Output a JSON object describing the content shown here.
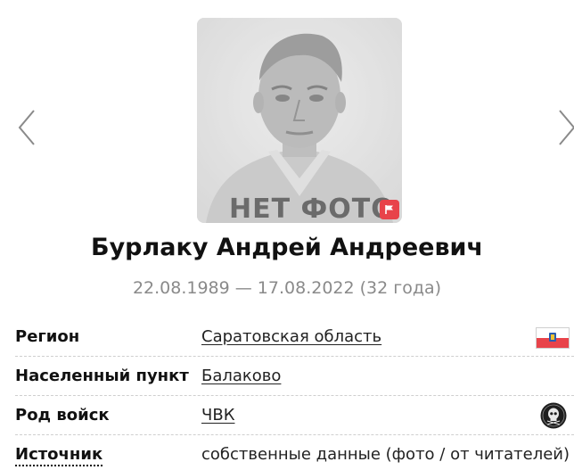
{
  "photo": {
    "placeholder_text": "НЕТ ФОТО",
    "icon": "flag-icon"
  },
  "navigation": {
    "prev_icon": "chevron-left-icon",
    "next_icon": "chevron-right-icon"
  },
  "person": {
    "name": "Бурлаку Андрей Андреевич",
    "dates": "22.08.1989 — 17.08.2022 (32 года)"
  },
  "details": [
    {
      "label": "Регион",
      "value": "Саратовская область",
      "icon": "region-flag-icon"
    },
    {
      "label": "Населенный пункт",
      "value": "Балаково"
    },
    {
      "label": "Род войск",
      "value": "ЧВК",
      "icon": "skull-emblem-icon"
    },
    {
      "label": "Источник",
      "value": "собственные данные (фото / от читателей)"
    }
  ],
  "colors": {
    "accent_red": "#e8434a",
    "muted_text": "#8a8a8a",
    "divider": "#cfcfcf"
  }
}
